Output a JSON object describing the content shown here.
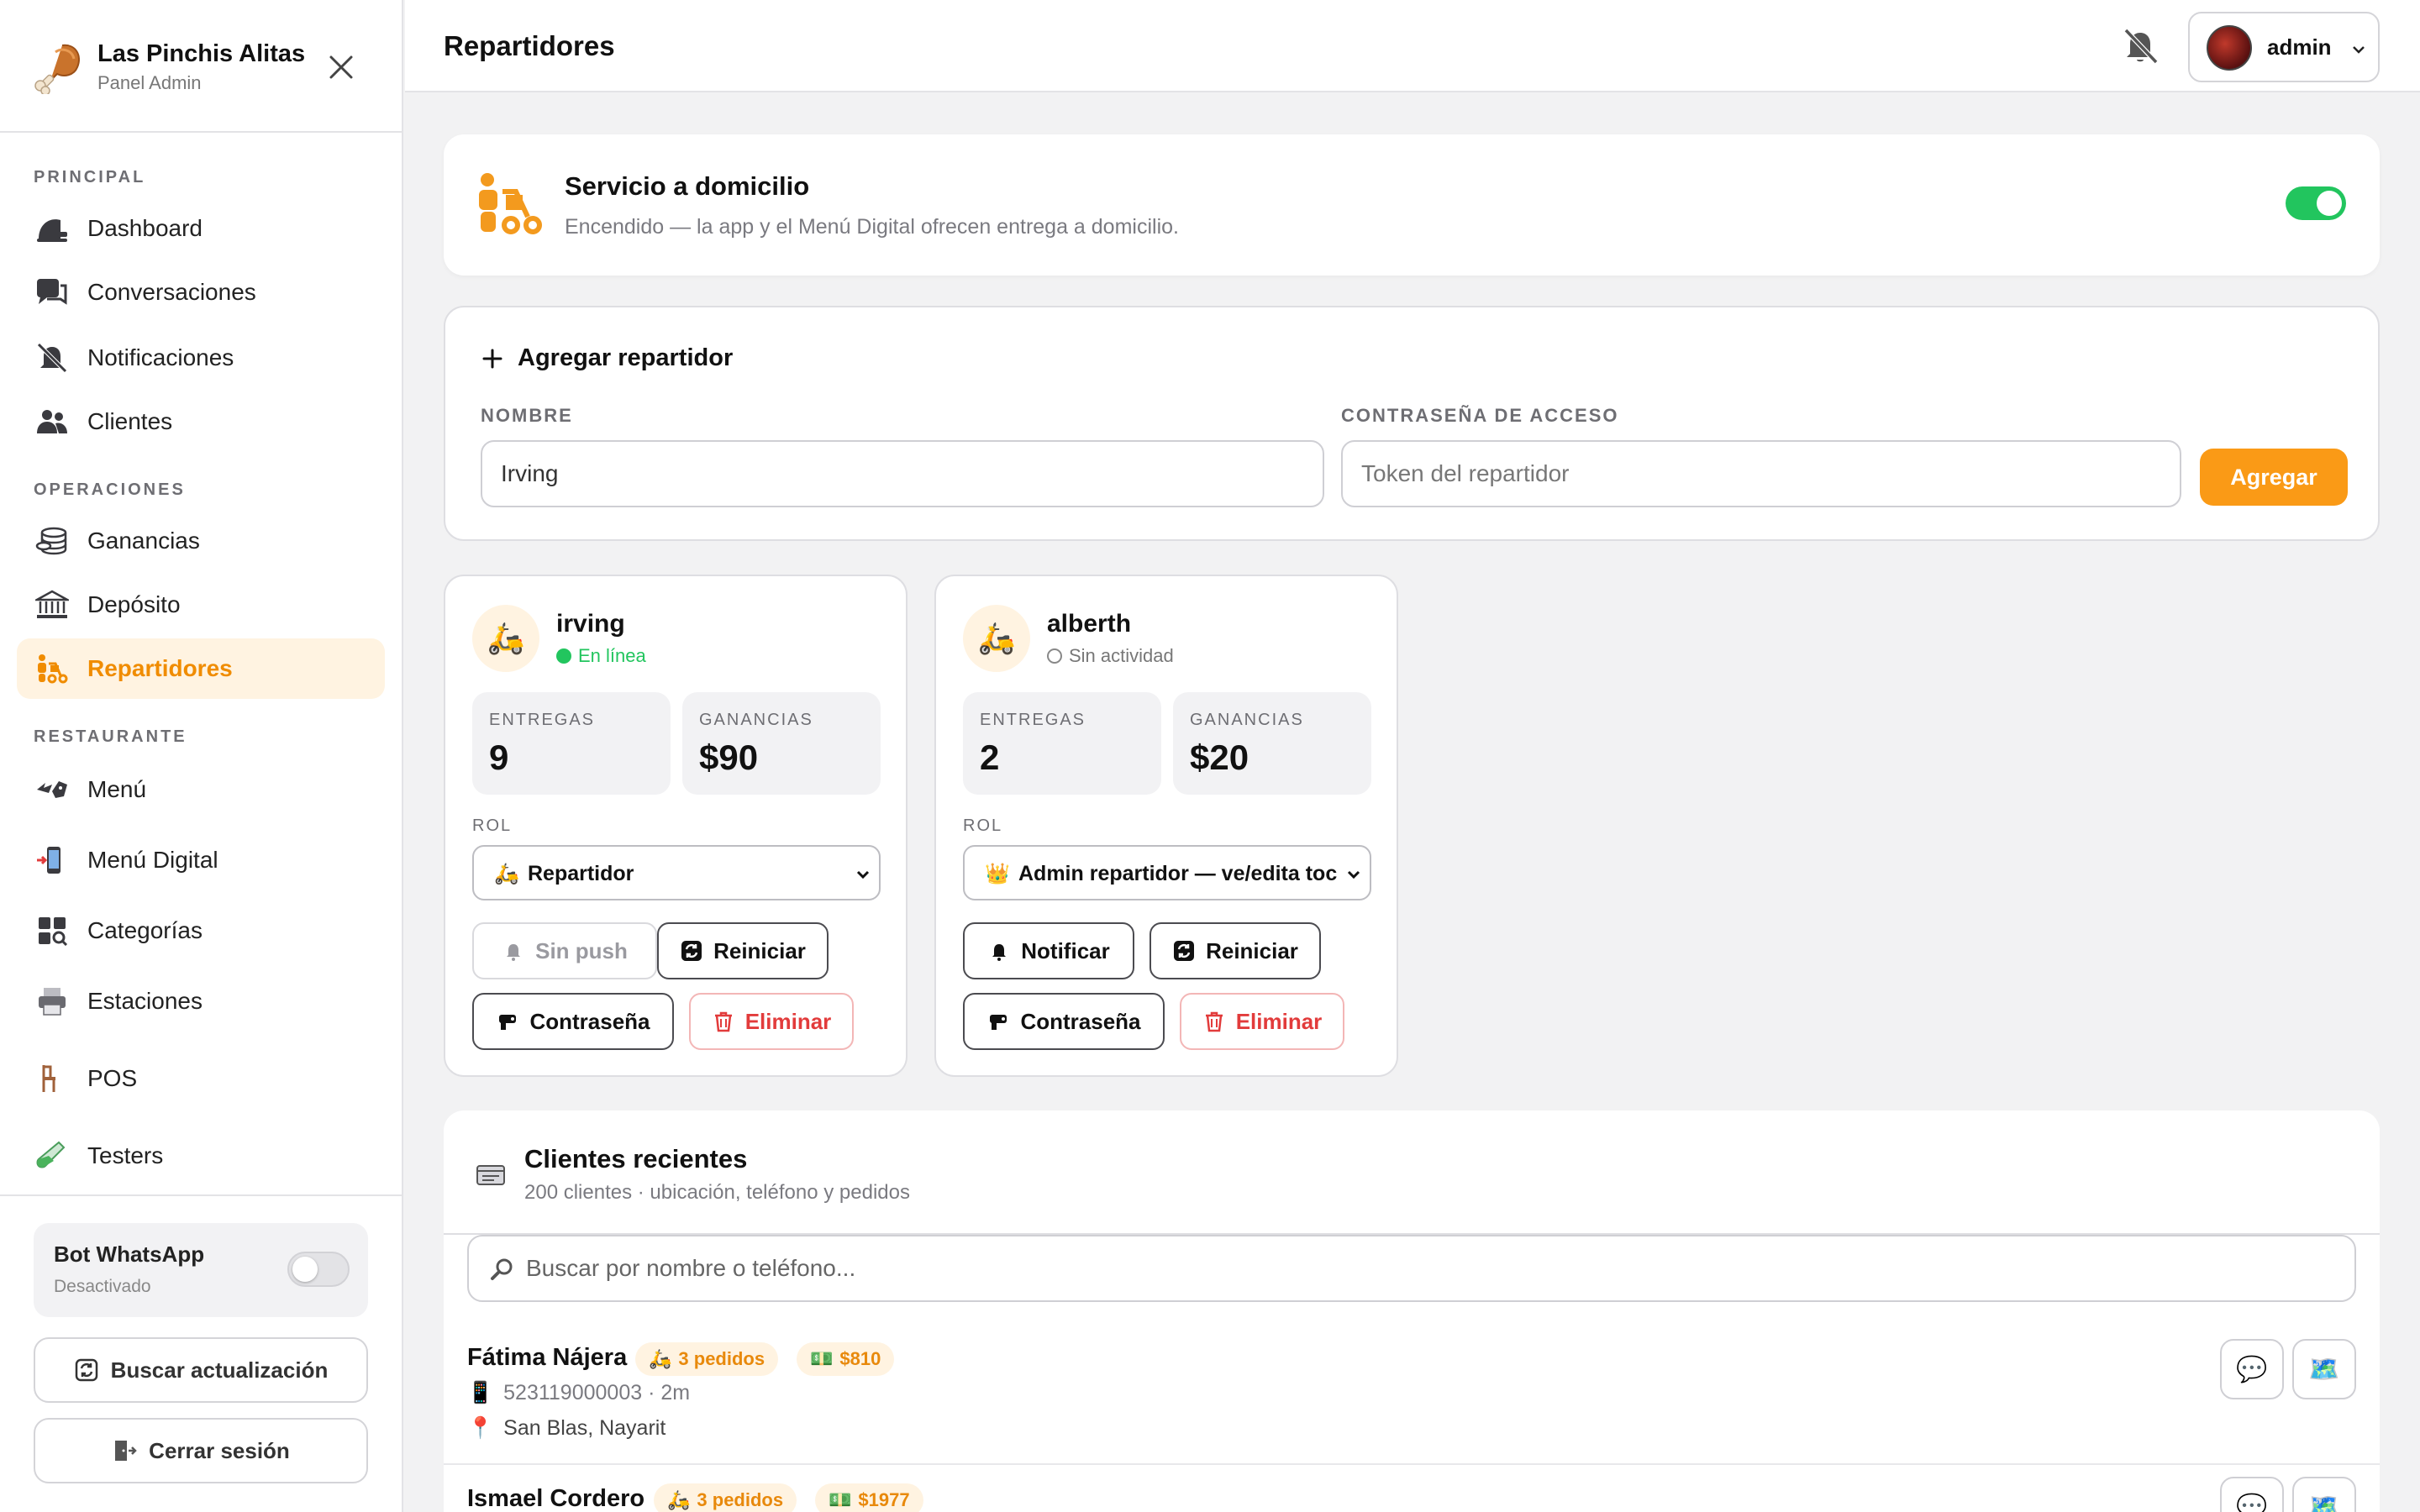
{
  "brand": {
    "name": "Las Pinchis Alitas",
    "subtitle": "Panel Admin"
  },
  "sidebar": {
    "sections": [
      "PRINCIPAL",
      "OPERACIONES",
      "RESTAURANTE"
    ],
    "items": [
      {
        "label": "Dashboard",
        "icon": "dashboard-icon"
      },
      {
        "label": "Conversaciones",
        "icon": "chat-icon"
      },
      {
        "label": "Notificaciones",
        "icon": "bell-off-icon"
      },
      {
        "label": "Clientes",
        "icon": "users-icon"
      },
      {
        "label": "Ganancias",
        "icon": "coins-icon"
      },
      {
        "label": "Depósito",
        "icon": "bank-icon"
      },
      {
        "label": "Repartidores",
        "icon": "delivery-icon",
        "active": true
      },
      {
        "label": "Menú",
        "icon": "wings-icon"
      },
      {
        "label": "Menú Digital",
        "icon": "phone-icon"
      },
      {
        "label": "Categorías",
        "icon": "grid-icon"
      },
      {
        "label": "Estaciones",
        "icon": "printer-icon"
      },
      {
        "label": "POS",
        "icon": "chair-icon"
      },
      {
        "label": "Testers",
        "icon": "test-tube-icon"
      }
    ],
    "bot": {
      "title": "Bot WhatsApp",
      "status": "Desactivado",
      "enabled": false
    },
    "update_label": "Buscar actualización",
    "logout_label": "Cerrar sesión"
  },
  "topbar": {
    "title": "Repartidores",
    "user": "admin"
  },
  "delivery": {
    "title": "Servicio a domicilio",
    "description": "Encendido — la app y el Menú Digital ofrecen entrega a domicilio.",
    "enabled": true
  },
  "add_driver": {
    "title": "Agregar repartidor",
    "name_label": "NOMBRE",
    "name_value": "Irving",
    "password_label": "CONTRASEÑA DE ACCESO",
    "password_placeholder": "Token del repartidor",
    "submit_label": "Agregar"
  },
  "drivers": [
    {
      "name": "irving",
      "status": "En línea",
      "status_color": "#22c55e",
      "online": true,
      "deliveries_label": "ENTREGAS",
      "deliveries": "9",
      "earnings_label": "GANANCIAS",
      "earnings": "$90",
      "role_label": "ROL",
      "role": "Repartidor",
      "notify_label": "Sin push",
      "reset_label": "Reiniciar",
      "password_label": "Contraseña",
      "delete_label": "Eliminar"
    },
    {
      "name": "alberth",
      "status": "Sin actividad",
      "status_color": "#888888",
      "online": false,
      "deliveries_label": "ENTREGAS",
      "deliveries": "2",
      "earnings_label": "GANANCIAS",
      "earnings": "$20",
      "role_label": "ROL",
      "role": "Admin repartidor — ve/edita toc",
      "notify_label": "Notificar",
      "reset_label": "Reiniciar",
      "password_label": "Contraseña",
      "delete_label": "Eliminar"
    }
  ],
  "clients": {
    "title": "Clientes recientes",
    "subtitle": "200 clientes · ubicación, teléfono y pedidos",
    "search_placeholder": "Buscar por nombre o teléfono...",
    "rows": [
      {
        "name": "Fátima Nájera",
        "orders": "3 pedidos",
        "total": "$810",
        "phone": "523119000003 · 2m",
        "location": "San Blas, Nayarit"
      },
      {
        "name": "Ismael Cordero",
        "orders": "3 pedidos",
        "total": "$1977"
      }
    ]
  },
  "colors": {
    "accent": "#fa9a16",
    "active_bg": "#fff3e1",
    "online": "#22c55e",
    "danger": "#e23b3b"
  }
}
